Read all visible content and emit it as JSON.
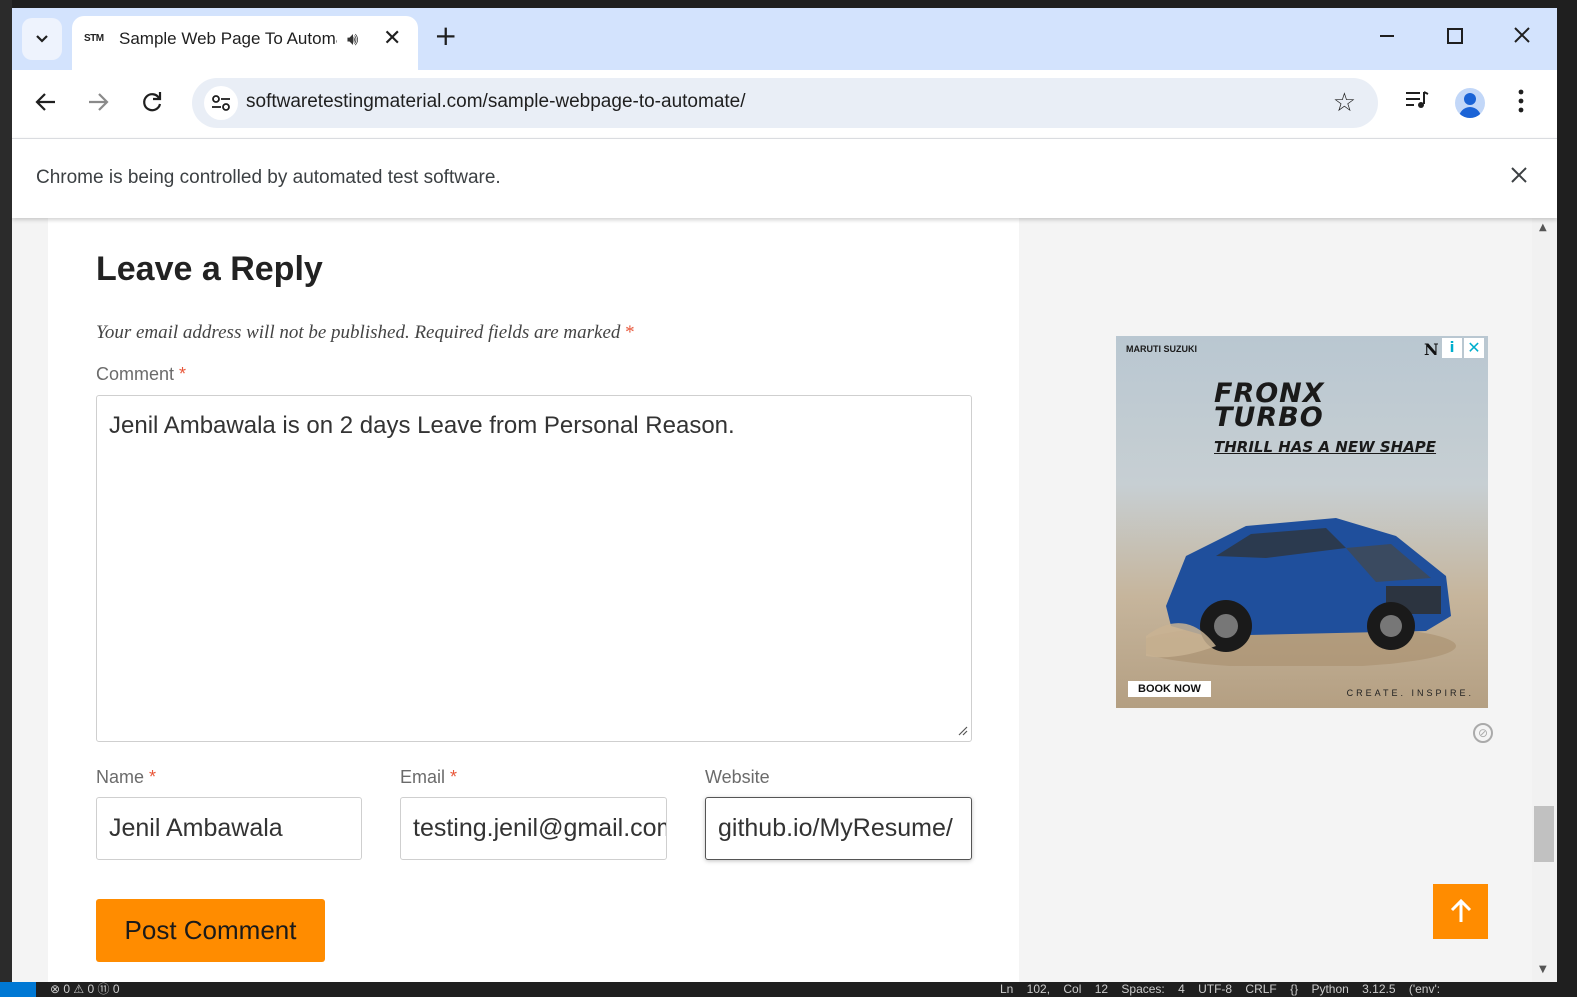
{
  "browser": {
    "tab": {
      "favicon_text": "STM",
      "title": "Sample Web Page To Automate",
      "audio_icon": "speaker-icon",
      "close_icon": "close-icon"
    },
    "new_tab_label": "+",
    "window_controls": {
      "minimize": "—",
      "maximize": "☐",
      "close": "✕"
    },
    "url": "softwaretestingmaterial.com/sample-webpage-to-automate/",
    "automation_notice": "Chrome is being controlled by automated test software."
  },
  "page": {
    "section_title": "Leave a Reply",
    "notes": "Your email address will not be published. Required fields are marked",
    "required_mark": "*",
    "comment": {
      "label": "Comment",
      "value": "Jenil Ambawala is on 2 days Leave from Personal Reason."
    },
    "name": {
      "label": "Name",
      "value": "Jenil Ambawala"
    },
    "email": {
      "label": "Email",
      "value": "testing.jenil@gmail.com"
    },
    "website": {
      "label": "Website",
      "value": "github.io/MyResume/"
    },
    "submit_label": "Post Comment",
    "back_to_top_icon": "arrow-up-icon"
  },
  "ad": {
    "brand": "MARUTI SUZUKI",
    "model_line1": "FRONX",
    "model_line2": "TURBO",
    "tagline": "THRILL HAS A NEW SHAPE",
    "cta": "BOOK NOW",
    "footer": "CREATE. INSPIRE.",
    "n_mark": "N",
    "info_mark": "i",
    "close_mark": "✕"
  },
  "colors": {
    "accent": "#ff8c00",
    "tabstrip": "#d3e3fd",
    "required": "#e8573a"
  },
  "status_bar": {
    "problems": "⊗ 0 ⚠ 0  ⑪ 0",
    "right": "Ln 102, Col 12  Spaces: 4  UTF-8  CRLF  {} Python  3.12.5 ('env':"
  }
}
